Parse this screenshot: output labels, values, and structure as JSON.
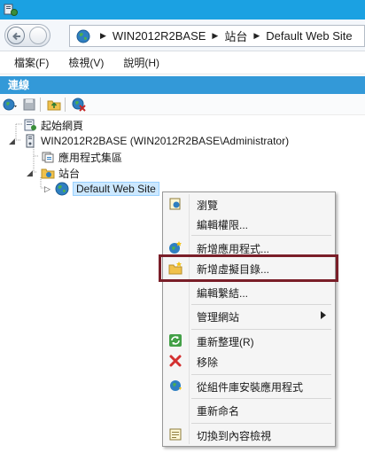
{
  "window": {
    "app_icon": "iis-manager-icon",
    "titlebar_color": "#1ba1e2"
  },
  "address_bar": {
    "globe_icon": "globe-icon",
    "segments": [
      "WIN2012R2BASE",
      "站台",
      "Default Web Site"
    ]
  },
  "menu": {
    "items": [
      "檔案(F)",
      "檢視(V)",
      "說明(H)"
    ]
  },
  "connections_panel": {
    "title": "連線",
    "header_color": "#3399d8"
  },
  "tree": {
    "start_page": "起始網頁",
    "server": "WIN2012R2BASE (WIN2012R2BASE\\Administrator)",
    "app_pools": "應用程式集區",
    "sites": "站台",
    "default_site": "Default Web Site"
  },
  "context_menu": {
    "items": [
      {
        "label": "瀏覽",
        "icon": "browse-icon"
      },
      {
        "label": "編輯權限...",
        "icon": ""
      },
      {
        "label": "新增應用程式...",
        "icon": "add-application-icon"
      },
      {
        "label": "新增虛擬目錄...",
        "icon": "add-virtual-directory-icon"
      },
      {
        "label": "編輯繫結...",
        "icon": ""
      },
      {
        "label": "管理網站",
        "icon": ""
      },
      {
        "label": "重新整理(R)",
        "icon": "refresh-icon"
      },
      {
        "label": "移除",
        "icon": "remove-icon"
      },
      {
        "label": "從組件庫安裝應用程式",
        "icon": "install-from-gallery-icon"
      },
      {
        "label": "重新命名",
        "icon": ""
      },
      {
        "label": "切換到內容檢視",
        "icon": "content-view-icon"
      }
    ],
    "highlight_color": "#7a1e28"
  }
}
